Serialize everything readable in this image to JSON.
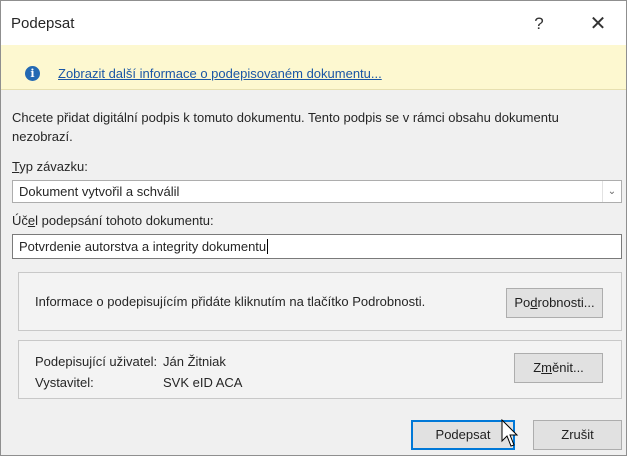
{
  "window": {
    "title": "Podepsat",
    "help_glyph": "?",
    "close_glyph": "✕"
  },
  "infobar": {
    "icon": "info-icon",
    "icon_glyph": "i",
    "link_text": "Zobrazit další informace o podepisovaném dokumentu..."
  },
  "description": "Chcete přidat digitální podpis k tomuto dokumentu. Tento podpis se v rámci obsahu dokumentu nezobrazí.",
  "commitment": {
    "label_accel": "T",
    "label_rest": "yp závazku:",
    "selected": "Dokument vytvořil a schválil",
    "arrow_glyph": "⌄"
  },
  "purpose": {
    "label_pre": "Úč",
    "label_accel": "e",
    "label_post": "l podepsání tohoto dokumentu:",
    "value": "Potvrdenie autorstva a integrity dokumentu"
  },
  "details_group": {
    "text": "Informace o podepisujícím přidáte kliknutím na tlačítko Podrobnosti.",
    "button_pre": "Po",
    "button_accel": "d",
    "button_post": "robnosti..."
  },
  "signer_group": {
    "signer_key": "Podepisující uživatel:",
    "signer_value": "Ján Žitniak",
    "issuer_key": "Vystavitel:",
    "issuer_value": "SVK eID ACA",
    "change_pre": "Z",
    "change_accel": "m",
    "change_post": "ěnit..."
  },
  "footer": {
    "sign_label": "Podepsat",
    "cancel_label": "Zrušit"
  },
  "colors": {
    "accent": "#0078d7",
    "link": "#1a56a5",
    "infobar_bg": "#fdf8d0"
  }
}
